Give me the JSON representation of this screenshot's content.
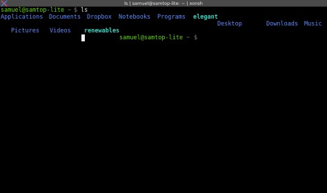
{
  "window": {
    "title": "ls | samuel@samtop-lite: ~ | xonsh"
  },
  "terminal": {
    "prompt1": {
      "user_host": "samuel@samtop-lite",
      "path": "~",
      "symbol": "$",
      "command": "ls"
    },
    "listing": {
      "row1": [
        "Applications",
        "Documents",
        "Dropbox",
        "Notebooks",
        "Programs",
        "elegant",
        "Desktop",
        "Downloads",
        "Music"
      ],
      "row2": [
        "Pictures",
        "Videos",
        "renewables"
      ]
    },
    "prompt2": {
      "user_host": "samuel@samtop-lite",
      "path": "~",
      "symbol": "$"
    }
  },
  "colors": {
    "prompt_user": "#5fd700",
    "directory": "#5c8cff",
    "highlight_dir": "#33d6c4",
    "background": "#000000",
    "titlebar": "#4a4a4a"
  }
}
